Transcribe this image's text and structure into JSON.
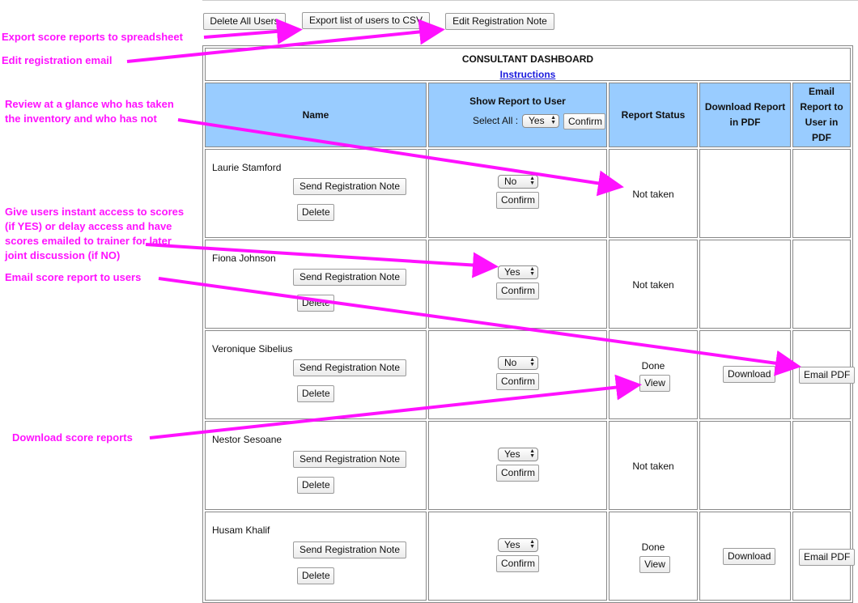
{
  "toolbar": {
    "delete_all": "Delete All Users",
    "export_csv": "Export list of users to CSV",
    "edit_note": "Edit Registration Note"
  },
  "dashboard": {
    "title": "CONSULTANT DASHBOARD",
    "instructions": "Instructions",
    "headers": {
      "name": "Name",
      "show_report": "Show Report to User",
      "select_all": "Select All :",
      "select_all_value": "Yes",
      "confirm": "Confirm",
      "status": "Report Status",
      "download": "Download Report in PDF",
      "email": "Email Report to User in PDF"
    },
    "row_buttons": {
      "send_note": "Send Registration Note",
      "delete": "Delete",
      "confirm": "Confirm",
      "view": "View",
      "download": "Download",
      "email_pdf": "Email PDF"
    },
    "rows": [
      {
        "name": "Laurie Stamford",
        "show": "No",
        "status": "Not taken"
      },
      {
        "name": "Fiona Johnson",
        "show": "Yes",
        "status": "Not taken"
      },
      {
        "name": "Veronique Sibelius",
        "show": "No",
        "status": "Done"
      },
      {
        "name": "Nestor Sesoane",
        "show": "Yes",
        "status": "Not taken"
      },
      {
        "name": "Husam Khalif",
        "show": "Yes",
        "status": "Done"
      }
    ]
  },
  "annotations": {
    "export": "Export score reports to spreadsheet",
    "edit_email": "Edit registration email",
    "review_1": "Review at a glance who has taken",
    "review_2": "the inventory and who has not",
    "access_1": "Give users instant access to scores",
    "access_2": "(if YES) or delay access and have",
    "access_3": "scores emailed to trainer for later",
    "access_4": "joint discussion (if NO)",
    "email": "Email score report to users",
    "download": "Download score reports"
  },
  "colors": {
    "annotation": "#ff11ff",
    "header_bg": "#99ccff",
    "link": "#1a1add"
  }
}
